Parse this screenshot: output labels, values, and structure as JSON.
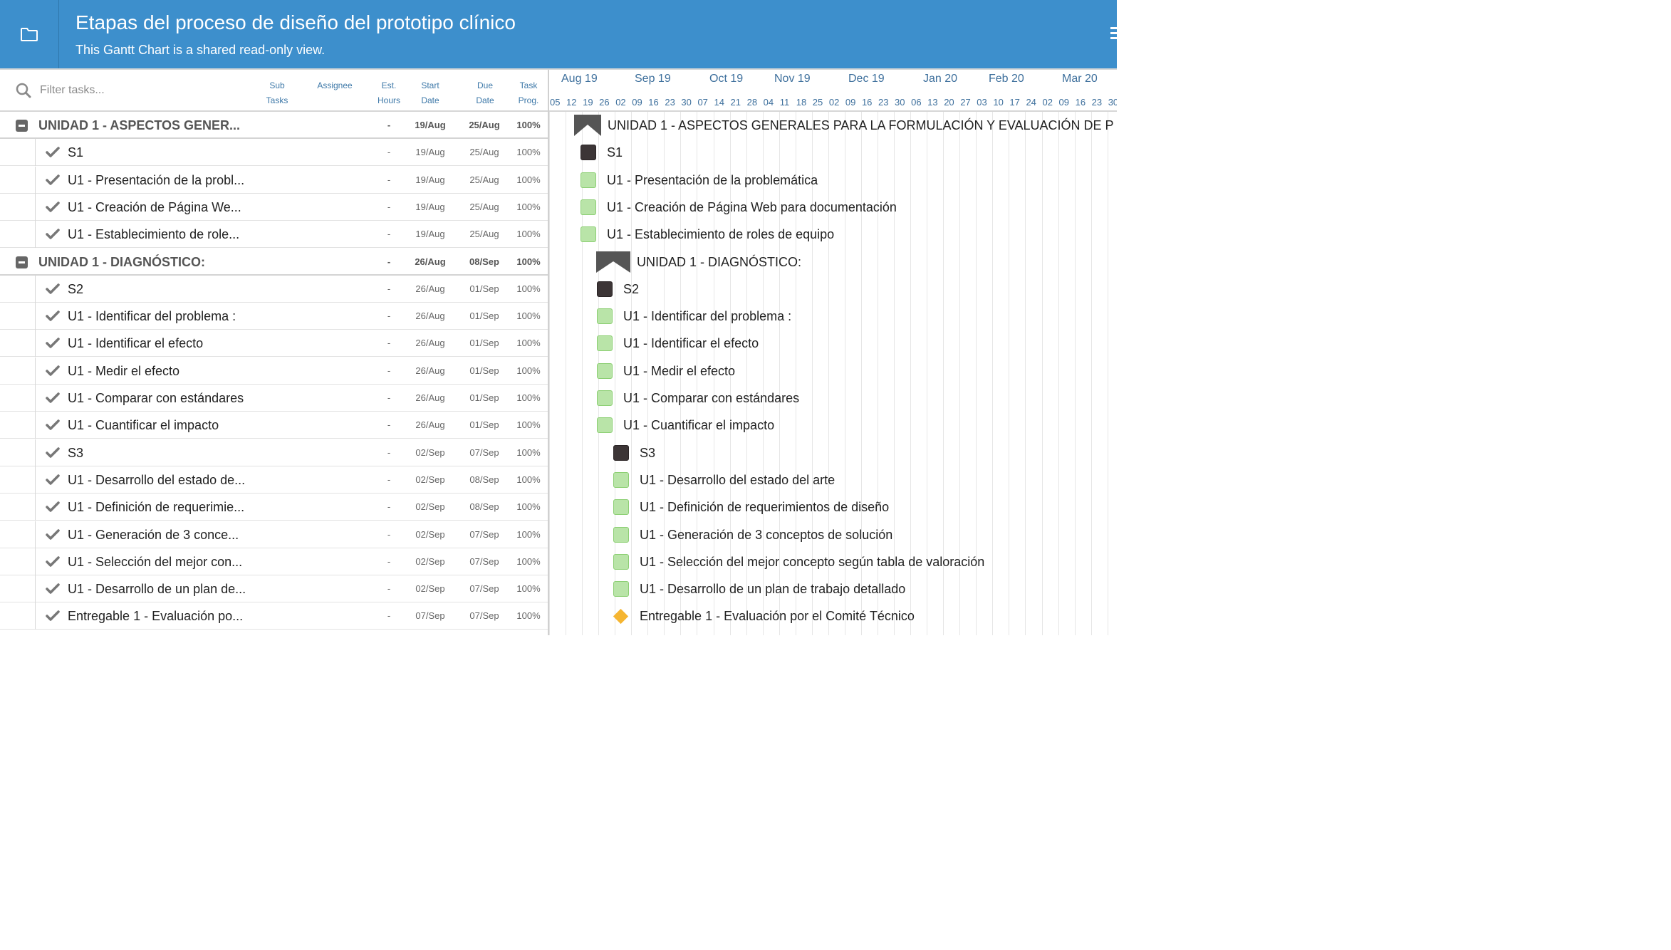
{
  "header": {
    "title": "Etapas del proceso de diseño del prototipo clínico",
    "subtitle": "This Gantt Chart is a shared read-only view."
  },
  "grid": {
    "filter_placeholder": "Filter tasks...",
    "columns": {
      "sub_tasks": [
        "Sub",
        "Tasks"
      ],
      "assignee": "Assignee",
      "est_hours": [
        "Est.",
        "Hours"
      ],
      "start_date": [
        "Start",
        "Date"
      ],
      "due_date": [
        "Due",
        "Date"
      ],
      "task_prog": [
        "Task",
        "Prog."
      ]
    }
  },
  "rows": [
    {
      "type": "group",
      "name": "UNIDAD 1 - ASPECTOS GENER...",
      "hours": "-",
      "start": "19/Aug",
      "due": "25/Aug",
      "prog": "100%"
    },
    {
      "type": "task",
      "name": "S1",
      "hours": "-",
      "start": "19/Aug",
      "due": "25/Aug",
      "prog": "100%"
    },
    {
      "type": "task",
      "name": "U1 - Presentación de la probl...",
      "hours": "-",
      "start": "19/Aug",
      "due": "25/Aug",
      "prog": "100%"
    },
    {
      "type": "task",
      "name": "U1 - Creación de Página We...",
      "hours": "-",
      "start": "19/Aug",
      "due": "25/Aug",
      "prog": "100%"
    },
    {
      "type": "task",
      "name": "U1 - Establecimiento de role...",
      "hours": "-",
      "start": "19/Aug",
      "due": "25/Aug",
      "prog": "100%"
    },
    {
      "type": "group",
      "name": "UNIDAD 1 - DIAGNÓSTICO:",
      "hours": "-",
      "start": "26/Aug",
      "due": "08/Sep",
      "prog": "100%"
    },
    {
      "type": "task",
      "name": "S2",
      "hours": "-",
      "start": "26/Aug",
      "due": "01/Sep",
      "prog": "100%"
    },
    {
      "type": "task",
      "name": "U1 - Identificar del problema :",
      "hours": "-",
      "start": "26/Aug",
      "due": "01/Sep",
      "prog": "100%"
    },
    {
      "type": "task",
      "name": "U1 - Identificar el efecto",
      "hours": "-",
      "start": "26/Aug",
      "due": "01/Sep",
      "prog": "100%"
    },
    {
      "type": "task",
      "name": "U1 - Medir el efecto",
      "hours": "-",
      "start": "26/Aug",
      "due": "01/Sep",
      "prog": "100%"
    },
    {
      "type": "task",
      "name": "U1 - Comparar con estándares",
      "hours": "-",
      "start": "26/Aug",
      "due": "01/Sep",
      "prog": "100%"
    },
    {
      "type": "task",
      "name": "U1 - Cuantificar el impacto",
      "hours": "-",
      "start": "26/Aug",
      "due": "01/Sep",
      "prog": "100%"
    },
    {
      "type": "task",
      "name": "S3",
      "hours": "-",
      "start": "02/Sep",
      "due": "07/Sep",
      "prog": "100%"
    },
    {
      "type": "task",
      "name": "U1 - Desarrollo del estado de...",
      "hours": "-",
      "start": "02/Sep",
      "due": "08/Sep",
      "prog": "100%"
    },
    {
      "type": "task",
      "name": "U1 - Definición de requerimie...",
      "hours": "-",
      "start": "02/Sep",
      "due": "08/Sep",
      "prog": "100%"
    },
    {
      "type": "task",
      "name": "U1 - Generación de 3 conce...",
      "hours": "-",
      "start": "02/Sep",
      "due": "07/Sep",
      "prog": "100%"
    },
    {
      "type": "task",
      "name": "U1 - Selección del mejor con...",
      "hours": "-",
      "start": "02/Sep",
      "due": "07/Sep",
      "prog": "100%"
    },
    {
      "type": "task",
      "name": "U1 - Desarrollo de un plan de...",
      "hours": "-",
      "start": "02/Sep",
      "due": "07/Sep",
      "prog": "100%"
    },
    {
      "type": "task",
      "name": "Entregable 1 - Evaluación po...",
      "hours": "-",
      "start": "07/Sep",
      "due": "07/Sep",
      "prog": "100%"
    }
  ],
  "timeline": {
    "months": [
      "Aug 19",
      "Sep 19",
      "Oct 19",
      "Nov 19",
      "Dec 19",
      "Jan 20",
      "Feb 20",
      "Mar 20"
    ],
    "weeks": [
      "05",
      "12",
      "19",
      "26",
      "02",
      "09",
      "16",
      "23",
      "30",
      "07",
      "14",
      "21",
      "28",
      "04",
      "11",
      "18",
      "25",
      "02",
      "09",
      "16",
      "23",
      "30",
      "06",
      "13",
      "20",
      "27",
      "03",
      "10",
      "17",
      "24",
      "02",
      "09",
      "16",
      "23",
      "30"
    ]
  },
  "chart_bars": [
    {
      "kind": "group",
      "label": "UNIDAD 1 - ASPECTOS GENERALES PARA LA FORMULACIÓN Y EVALUACIÓN DE P"
    },
    {
      "kind": "dark",
      "label": "S1"
    },
    {
      "kind": "done",
      "label": "U1 - Presentación de la problemática"
    },
    {
      "kind": "done",
      "label": "U1 - Creación de Página Web para documentación"
    },
    {
      "kind": "done",
      "label": "U1 - Establecimiento de roles de equipo"
    },
    {
      "kind": "group",
      "label": "UNIDAD 1 - DIAGNÓSTICO:"
    },
    {
      "kind": "dark",
      "label": "S2"
    },
    {
      "kind": "done",
      "label": "U1 - Identificar del problema :"
    },
    {
      "kind": "done",
      "label": "U1 - Identificar el efecto"
    },
    {
      "kind": "done",
      "label": "U1 - Medir el efecto"
    },
    {
      "kind": "done",
      "label": "U1 - Comparar con estándares"
    },
    {
      "kind": "done",
      "label": "U1 - Cuantificar el impacto"
    },
    {
      "kind": "dark",
      "label": "S3"
    },
    {
      "kind": "done",
      "label": "U1 - Desarrollo del estado del arte"
    },
    {
      "kind": "done",
      "label": "U1 - Definición de requerimientos de diseño"
    },
    {
      "kind": "done",
      "label": "U1 - Generación de 3 conceptos de solución"
    },
    {
      "kind": "done",
      "label": "U1 - Selección del mejor concepto según tabla de valoración"
    },
    {
      "kind": "done",
      "label": "U1 - Desarrollo de un plan de trabajo detallado"
    },
    {
      "kind": "milestone",
      "label": "Entregable 1 - Evaluación por el Comité Técnico"
    }
  ],
  "colors": {
    "header_bg": "#3d8fcc",
    "done_fill": "#b9e4a8",
    "dark_fill": "#3c3536",
    "milestone": "#f5b531"
  }
}
